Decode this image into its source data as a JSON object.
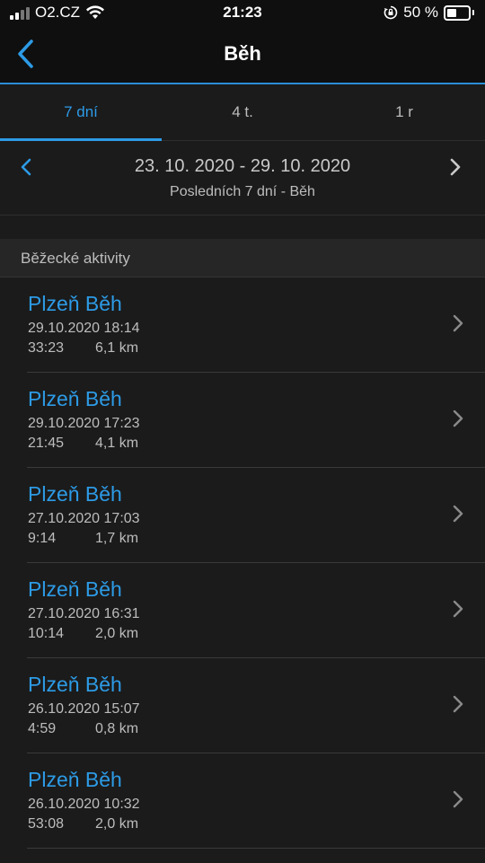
{
  "status_bar": {
    "carrier": "O2.CZ",
    "time": "21:23",
    "battery_percent_label": "50 %",
    "battery_level": 0.5
  },
  "nav": {
    "title": "Běh",
    "back_icon": "chevron-left-icon"
  },
  "tabs": [
    {
      "label": "7 dní",
      "active": true
    },
    {
      "label": "4 t.",
      "active": false
    },
    {
      "label": "1 r",
      "active": false
    }
  ],
  "range": {
    "title": "23. 10. 2020 - 29. 10. 2020",
    "subtitle": "Posledních 7 dní - Běh"
  },
  "section": {
    "title": "Běžecké aktivity"
  },
  "activities": [
    {
      "title": "Plzeň Běh",
      "date": "29.10.2020 18:14",
      "duration": "33:23",
      "distance": "6,1 km"
    },
    {
      "title": "Plzeň Běh",
      "date": "29.10.2020 17:23",
      "duration": "21:45",
      "distance": "4,1 km"
    },
    {
      "title": "Plzeň Běh",
      "date": "27.10.2020 17:03",
      "duration": "9:14",
      "distance": "1,7 km"
    },
    {
      "title": "Plzeň Běh",
      "date": "27.10.2020 16:31",
      "duration": "10:14",
      "distance": "2,0 km"
    },
    {
      "title": "Plzeň Běh",
      "date": "26.10.2020 15:07",
      "duration": "4:59",
      "distance": "0,8 km"
    },
    {
      "title": "Plzeň Běh",
      "date": "26.10.2020 10:32",
      "duration": "53:08",
      "distance": "2,0 km"
    }
  ],
  "colors": {
    "accent": "#2d9be6",
    "background": "#1b1b1b",
    "bar": "#0f0f0f"
  }
}
